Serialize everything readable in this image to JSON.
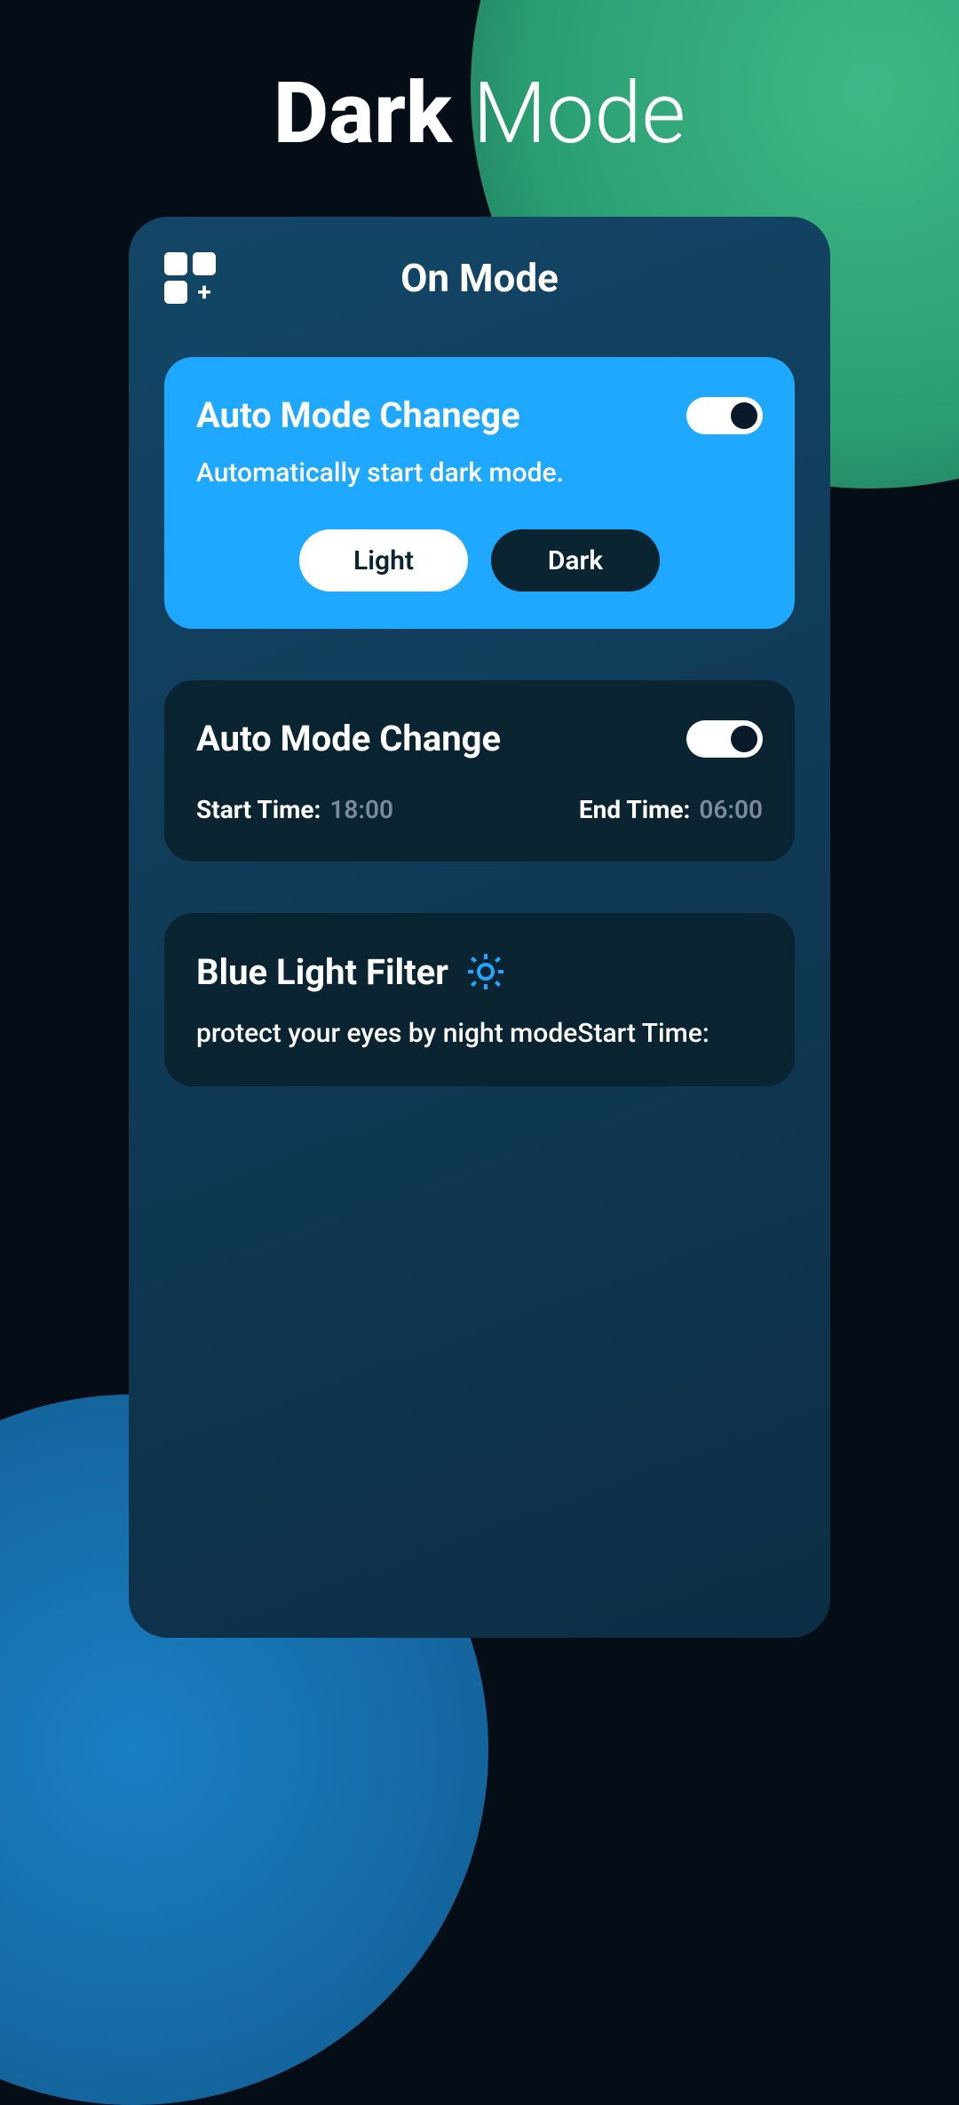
{
  "page": {
    "title_bold": "Dark",
    "title_light": "Mode"
  },
  "card": {
    "header_title": "On Mode"
  },
  "autoMode": {
    "title": "Auto Mode Chanege",
    "description": "Automatically start dark mode.",
    "light_label": "Light",
    "dark_label": "Dark"
  },
  "schedule": {
    "title": "Auto Mode Change",
    "start_label": "Start Time:",
    "start_value": "18:00",
    "end_label": "End Time:",
    "end_value": "06:00"
  },
  "blueLight": {
    "title": "Blue Light Filter",
    "description": "protect your eyes by night modeStart Time:"
  }
}
